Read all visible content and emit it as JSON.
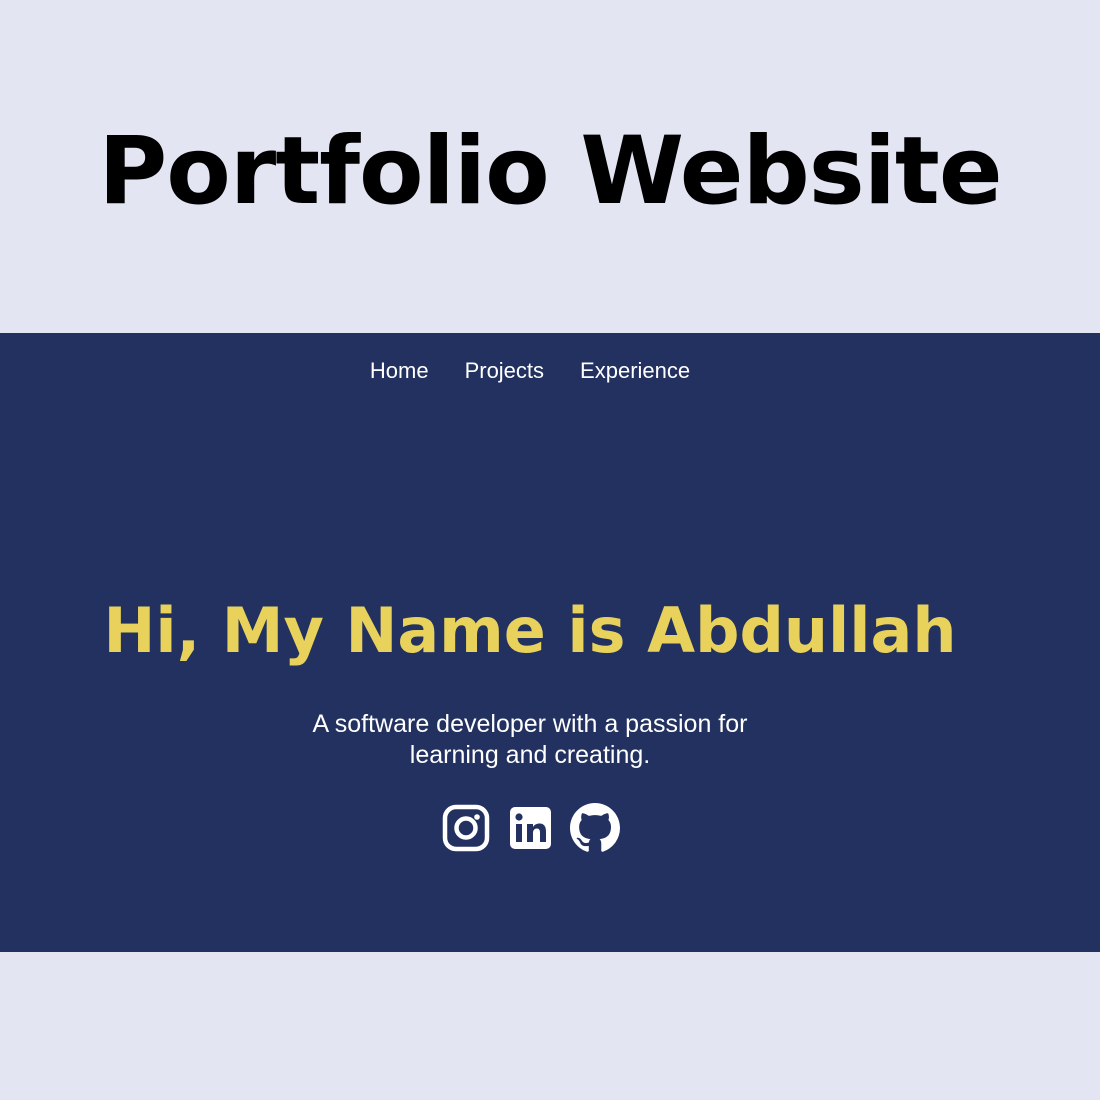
{
  "page": {
    "title": "Portfolio Website"
  },
  "nav": {
    "items": [
      {
        "label": "Home"
      },
      {
        "label": "Projects"
      },
      {
        "label": "Experience"
      }
    ]
  },
  "hero": {
    "heading": "Hi, My Name is Abdullah",
    "subtitle": "A software developer with a passion for learning and creating."
  },
  "socials": [
    {
      "icon": "instagram-icon"
    },
    {
      "icon": "linkedin-icon"
    },
    {
      "icon": "github-icon"
    }
  ],
  "colors": {
    "outer_background": "#e3e5f2",
    "site_background": "#223160",
    "heading_accent": "#e8d25c",
    "text_light": "#ffffff"
  }
}
